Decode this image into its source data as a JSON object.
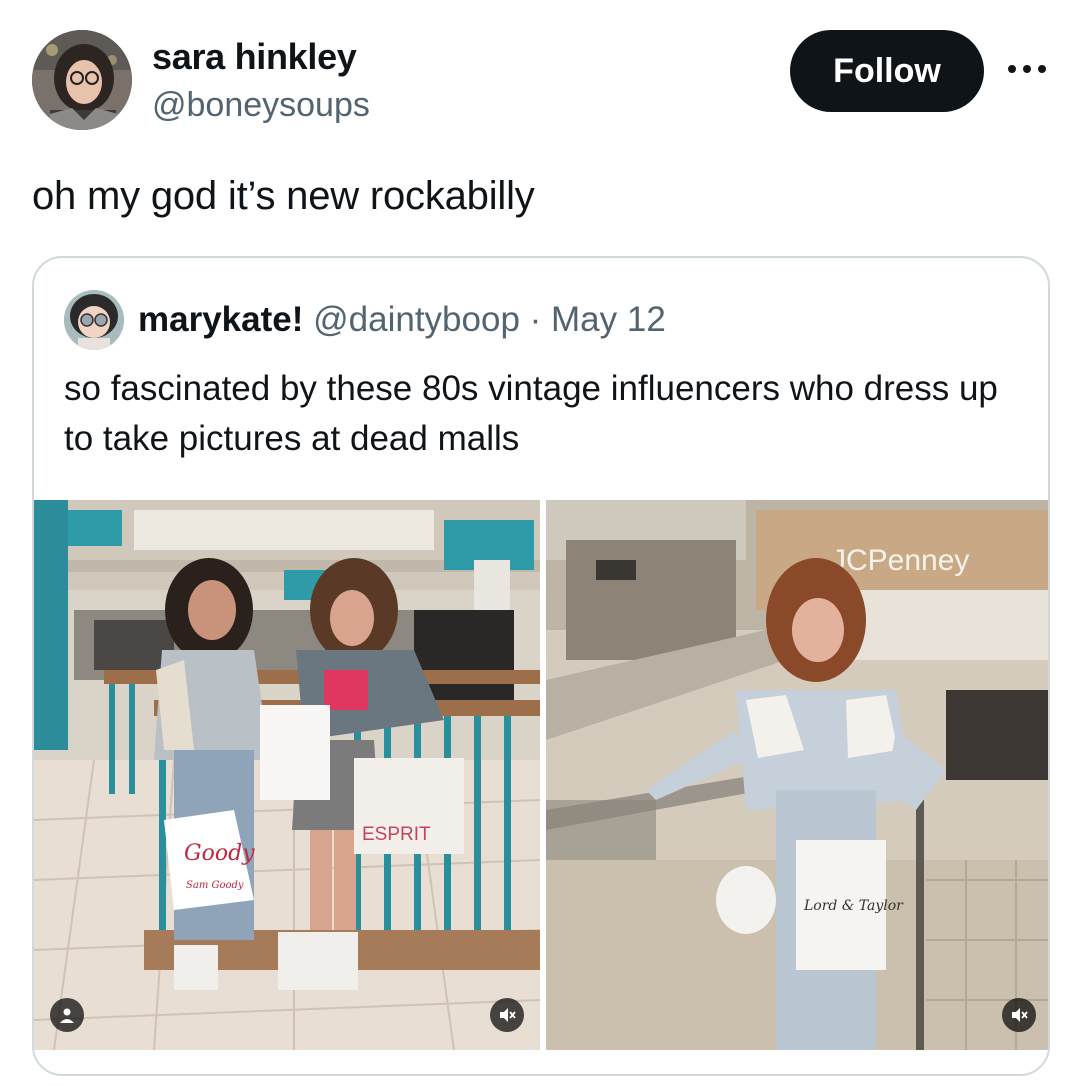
{
  "tweet": {
    "author_name": "sara hinkley",
    "author_handle": "@boneysoups",
    "follow_label": "Follow",
    "more_icon": "more-icon",
    "text": "oh my god it’s new rockabilly"
  },
  "quoted": {
    "author_name": "marykate!",
    "author_handle": "@daintyboop",
    "separator": " · ",
    "date": "May 12",
    "text": "so fascinated by these 80s vintage influencers who dress up to take pictures at dead malls",
    "images": [
      {
        "id": "photo-left",
        "bag_brand_1": "Esprit",
        "bag_text_1": "ESPRIT",
        "bag_brand_2": "Goody",
        "bag_text_2": "Goody",
        "bag_subtext_2": "Sam Goody"
      },
      {
        "id": "photo-right",
        "store_sign": "JCPenney",
        "bag_text": "Lord & Taylor"
      }
    ]
  },
  "colors": {
    "follow_bg": "#0f1419",
    "secondary_text": "#536471",
    "border": "#cfd9de"
  }
}
